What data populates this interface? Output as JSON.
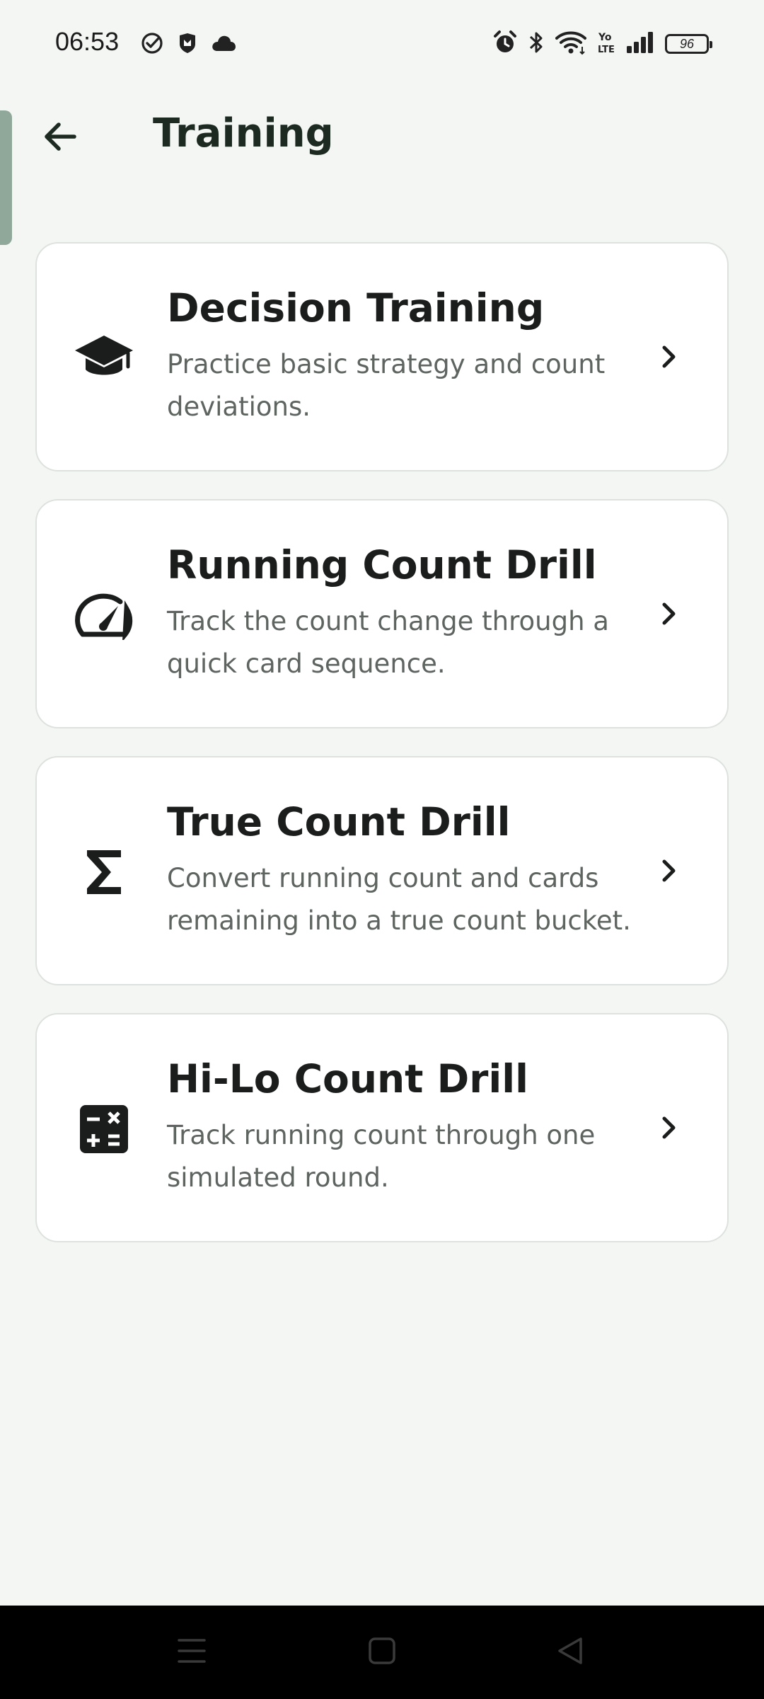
{
  "status_bar": {
    "time": "06:53",
    "battery_level": "96",
    "left_icons": [
      "check-circle-icon",
      "shield-icon",
      "cloud-icon"
    ],
    "right_icons": [
      "alarm-icon",
      "bluetooth-icon",
      "wifi-icon",
      "volte-icon",
      "signal-icon",
      "battery-icon"
    ]
  },
  "app_bar": {
    "title": "Training",
    "back_icon": "arrow-left-icon"
  },
  "cards": [
    {
      "title": "Decision Training",
      "description": "Practice basic strategy and count deviations.",
      "icon": "graduation-cap-icon"
    },
    {
      "title": "Running Count Drill",
      "description": "Track the count change through a quick card sequence.",
      "icon": "speedometer-icon"
    },
    {
      "title": "True Count Drill",
      "description": "Convert running count and cards remaining into a true count bucket.",
      "icon": "sigma-icon"
    },
    {
      "title": "Hi-Lo Count Drill",
      "description": "Track running count through one simulated round.",
      "icon": "calculator-icon"
    }
  ],
  "nav_bar": {
    "icons": [
      "menu-icon",
      "home-square-icon",
      "back-triangle-icon"
    ]
  },
  "colors": {
    "background": "#f4f6f4",
    "card_background": "#ffffff",
    "card_border": "#dde2de",
    "title_text": "#1c2a22",
    "description_text": "#5e6460",
    "side_handle": "#8fa89a"
  }
}
